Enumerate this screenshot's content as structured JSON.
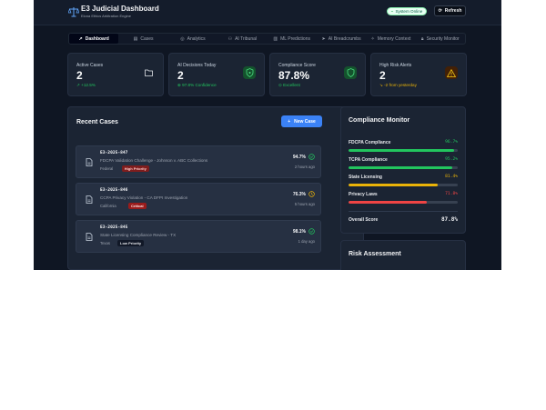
{
  "header": {
    "title": "E3 Judicial Dashboard",
    "subtitle": "Elona Ethics Arbitration Engine",
    "status": "System Online",
    "refresh": "Refresh"
  },
  "tabs": [
    {
      "label": "Dashboard",
      "icon": "trend-icon",
      "active": true
    },
    {
      "label": "Cases",
      "icon": "document-icon"
    },
    {
      "label": "Analytics",
      "icon": "target-icon"
    },
    {
      "label": "AI Tribunal",
      "icon": "users-icon"
    },
    {
      "label": "ML Predictions",
      "icon": "chart-icon"
    },
    {
      "label": "AI Breadcrumbs",
      "icon": "send-icon"
    },
    {
      "label": "Memory Context",
      "icon": "sparkle-icon"
    },
    {
      "label": "Security Monitor",
      "icon": "lock-icon"
    }
  ],
  "stats": [
    {
      "label": "Active Cases",
      "value": "2",
      "sub": "+12.5%",
      "icon": "folder-icon",
      "color": "#22c55e"
    },
    {
      "label": "AI Decisions Today",
      "value": "2",
      "sub": "97.8% Confidence",
      "icon": "shield-icon",
      "color": "#22c55e"
    },
    {
      "label": "Compliance Score",
      "value": "87.8%",
      "sub": "Excellent",
      "icon": "shield-check-icon",
      "color": "#22c55e"
    },
    {
      "label": "High Risk Alerts",
      "value": "2",
      "sub": "-2 from yesterday",
      "icon": "warning-icon",
      "color": "#eab308"
    }
  ],
  "recent": {
    "title": "Recent Cases",
    "new_case": "New Case",
    "cases": [
      {
        "id": "E3-2025-847",
        "title": "FDCPA Validation Challenge - Johnson v. ABC Collections",
        "state": "Federal",
        "badge": "High Priority",
        "badge_bg": "#7f1d1d",
        "badge_fg": "#fecaca",
        "score": "94.7%",
        "time": "2 hours ago",
        "score_icon": "check-circle-icon",
        "score_color": "#22c55e"
      },
      {
        "id": "E3-2025-846",
        "title": "CCPA Privacy Violation - CA DFPI Investigation",
        "state": "California",
        "badge": "Critical",
        "badge_bg": "#991b1b",
        "badge_fg": "#fee2e2",
        "score": "76.3%",
        "time": "5 hours ago",
        "score_icon": "clock-icon",
        "score_color": "#eab308"
      },
      {
        "id": "E3-2025-845",
        "title": "State Licensing Compliance Review - TX",
        "state": "Texas",
        "badge": "Low Priority",
        "badge_bg": "#111827",
        "badge_fg": "#e5e7eb",
        "score": "98.1%",
        "time": "1 day ago",
        "score_icon": "check-circle-icon",
        "score_color": "#22c55e"
      }
    ]
  },
  "compliance": {
    "title": "Compliance Monitor",
    "items": [
      {
        "label": "FDCPA Compliance",
        "value": "96.7%",
        "pct": 96.7,
        "color": "#22c55e"
      },
      {
        "label": "TCPA Compliance",
        "value": "95.2%",
        "pct": 95.2,
        "color": "#22c55e"
      },
      {
        "label": "State Licensing",
        "value": "81.4%",
        "pct": 81.4,
        "color": "#eab308"
      },
      {
        "label": "Privacy Laws",
        "value": "71.8%",
        "pct": 71.8,
        "color": "#ef4444"
      }
    ],
    "overall_label": "Overall Score",
    "overall_value": "87.8%"
  },
  "risk": {
    "title": "Risk Assessment"
  }
}
